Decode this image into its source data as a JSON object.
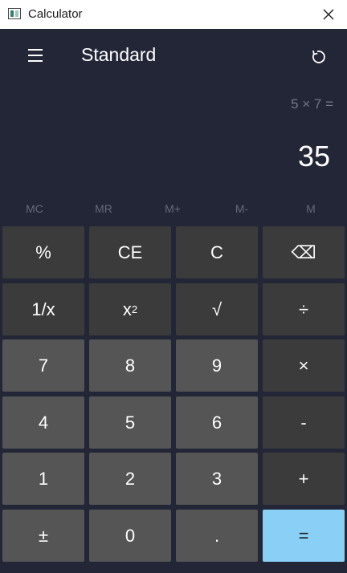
{
  "window": {
    "title": "Calculator"
  },
  "header": {
    "mode": "Standard"
  },
  "display": {
    "expression": "5 × 7 =",
    "result": "35"
  },
  "memory": [
    "MC",
    "MR",
    "M+",
    "M-",
    "M"
  ],
  "keys": [
    {
      "label": "%",
      "kind": "func",
      "name": "percent-key"
    },
    {
      "label": "CE",
      "kind": "func",
      "name": "clear-entry-key"
    },
    {
      "label": "C",
      "kind": "func",
      "name": "clear-key"
    },
    {
      "label": "⌫",
      "kind": "func",
      "name": "backspace-key"
    },
    {
      "label": "1/x",
      "kind": "func",
      "name": "reciprocal-key"
    },
    {
      "label": "x",
      "sup": "2",
      "kind": "func",
      "name": "square-key"
    },
    {
      "label": "√",
      "kind": "func",
      "name": "square-root-key"
    },
    {
      "label": "÷",
      "kind": "func",
      "name": "divide-key"
    },
    {
      "label": "7",
      "kind": "digit",
      "name": "digit-7-key"
    },
    {
      "label": "8",
      "kind": "digit",
      "name": "digit-8-key"
    },
    {
      "label": "9",
      "kind": "digit",
      "name": "digit-9-key"
    },
    {
      "label": "×",
      "kind": "func",
      "name": "multiply-key"
    },
    {
      "label": "4",
      "kind": "digit",
      "name": "digit-4-key"
    },
    {
      "label": "5",
      "kind": "digit",
      "name": "digit-5-key"
    },
    {
      "label": "6",
      "kind": "digit",
      "name": "digit-6-key"
    },
    {
      "label": "-",
      "kind": "func",
      "name": "subtract-key"
    },
    {
      "label": "1",
      "kind": "digit",
      "name": "digit-1-key"
    },
    {
      "label": "2",
      "kind": "digit",
      "name": "digit-2-key"
    },
    {
      "label": "3",
      "kind": "digit",
      "name": "digit-3-key"
    },
    {
      "label": "+",
      "kind": "func",
      "name": "add-key"
    },
    {
      "label": "±",
      "kind": "digit",
      "name": "negate-key"
    },
    {
      "label": "0",
      "kind": "digit",
      "name": "digit-0-key"
    },
    {
      "label": ".",
      "kind": "digit",
      "name": "decimal-key"
    },
    {
      "label": "=",
      "kind": "equals",
      "name": "equals-key"
    }
  ],
  "colors": {
    "app_background": "#232637",
    "function_key": "#3b3b3b",
    "digit_key": "#555555",
    "equals_key": "#8ad0f6"
  }
}
